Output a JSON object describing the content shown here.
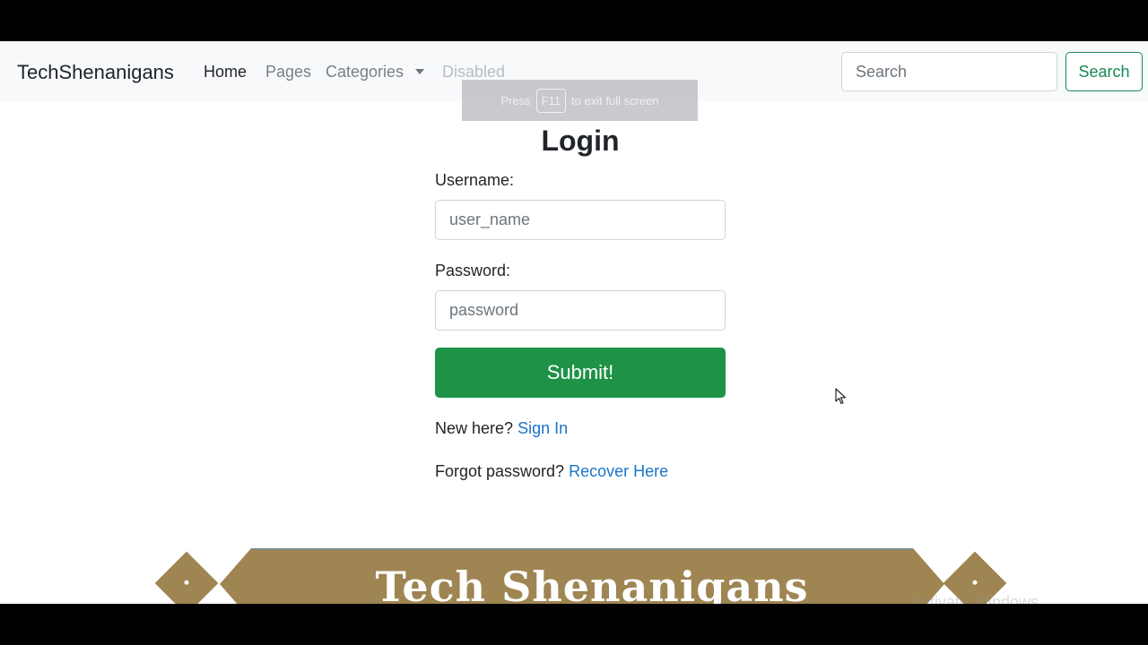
{
  "navbar": {
    "brand": "TechShenanigans",
    "links": [
      "Home",
      "Pages",
      "Categories",
      "Disabled"
    ],
    "search_placeholder": "Search",
    "search_button": "Search"
  },
  "fullscreen_notice": {
    "before": "Press",
    "key": "F11",
    "after": "to exit full screen"
  },
  "login": {
    "title": "Login",
    "username_label": "Username:",
    "username_placeholder": "user_name",
    "password_label": "Password:",
    "password_placeholder": "password",
    "submit_label": "Submit!",
    "new_here_text": "New here?",
    "sign_in_link": "Sign In",
    "forgot_text": "Forgot password?",
    "recover_link": "Recover Here"
  },
  "banner": {
    "title": "Tech Shenanigans"
  },
  "watermark": "Activate Windows",
  "colors": {
    "primary_green": "#1e9246",
    "outline_green": "#198754",
    "link_blue": "#1a75c9",
    "banner_gold": "#9e8552"
  }
}
